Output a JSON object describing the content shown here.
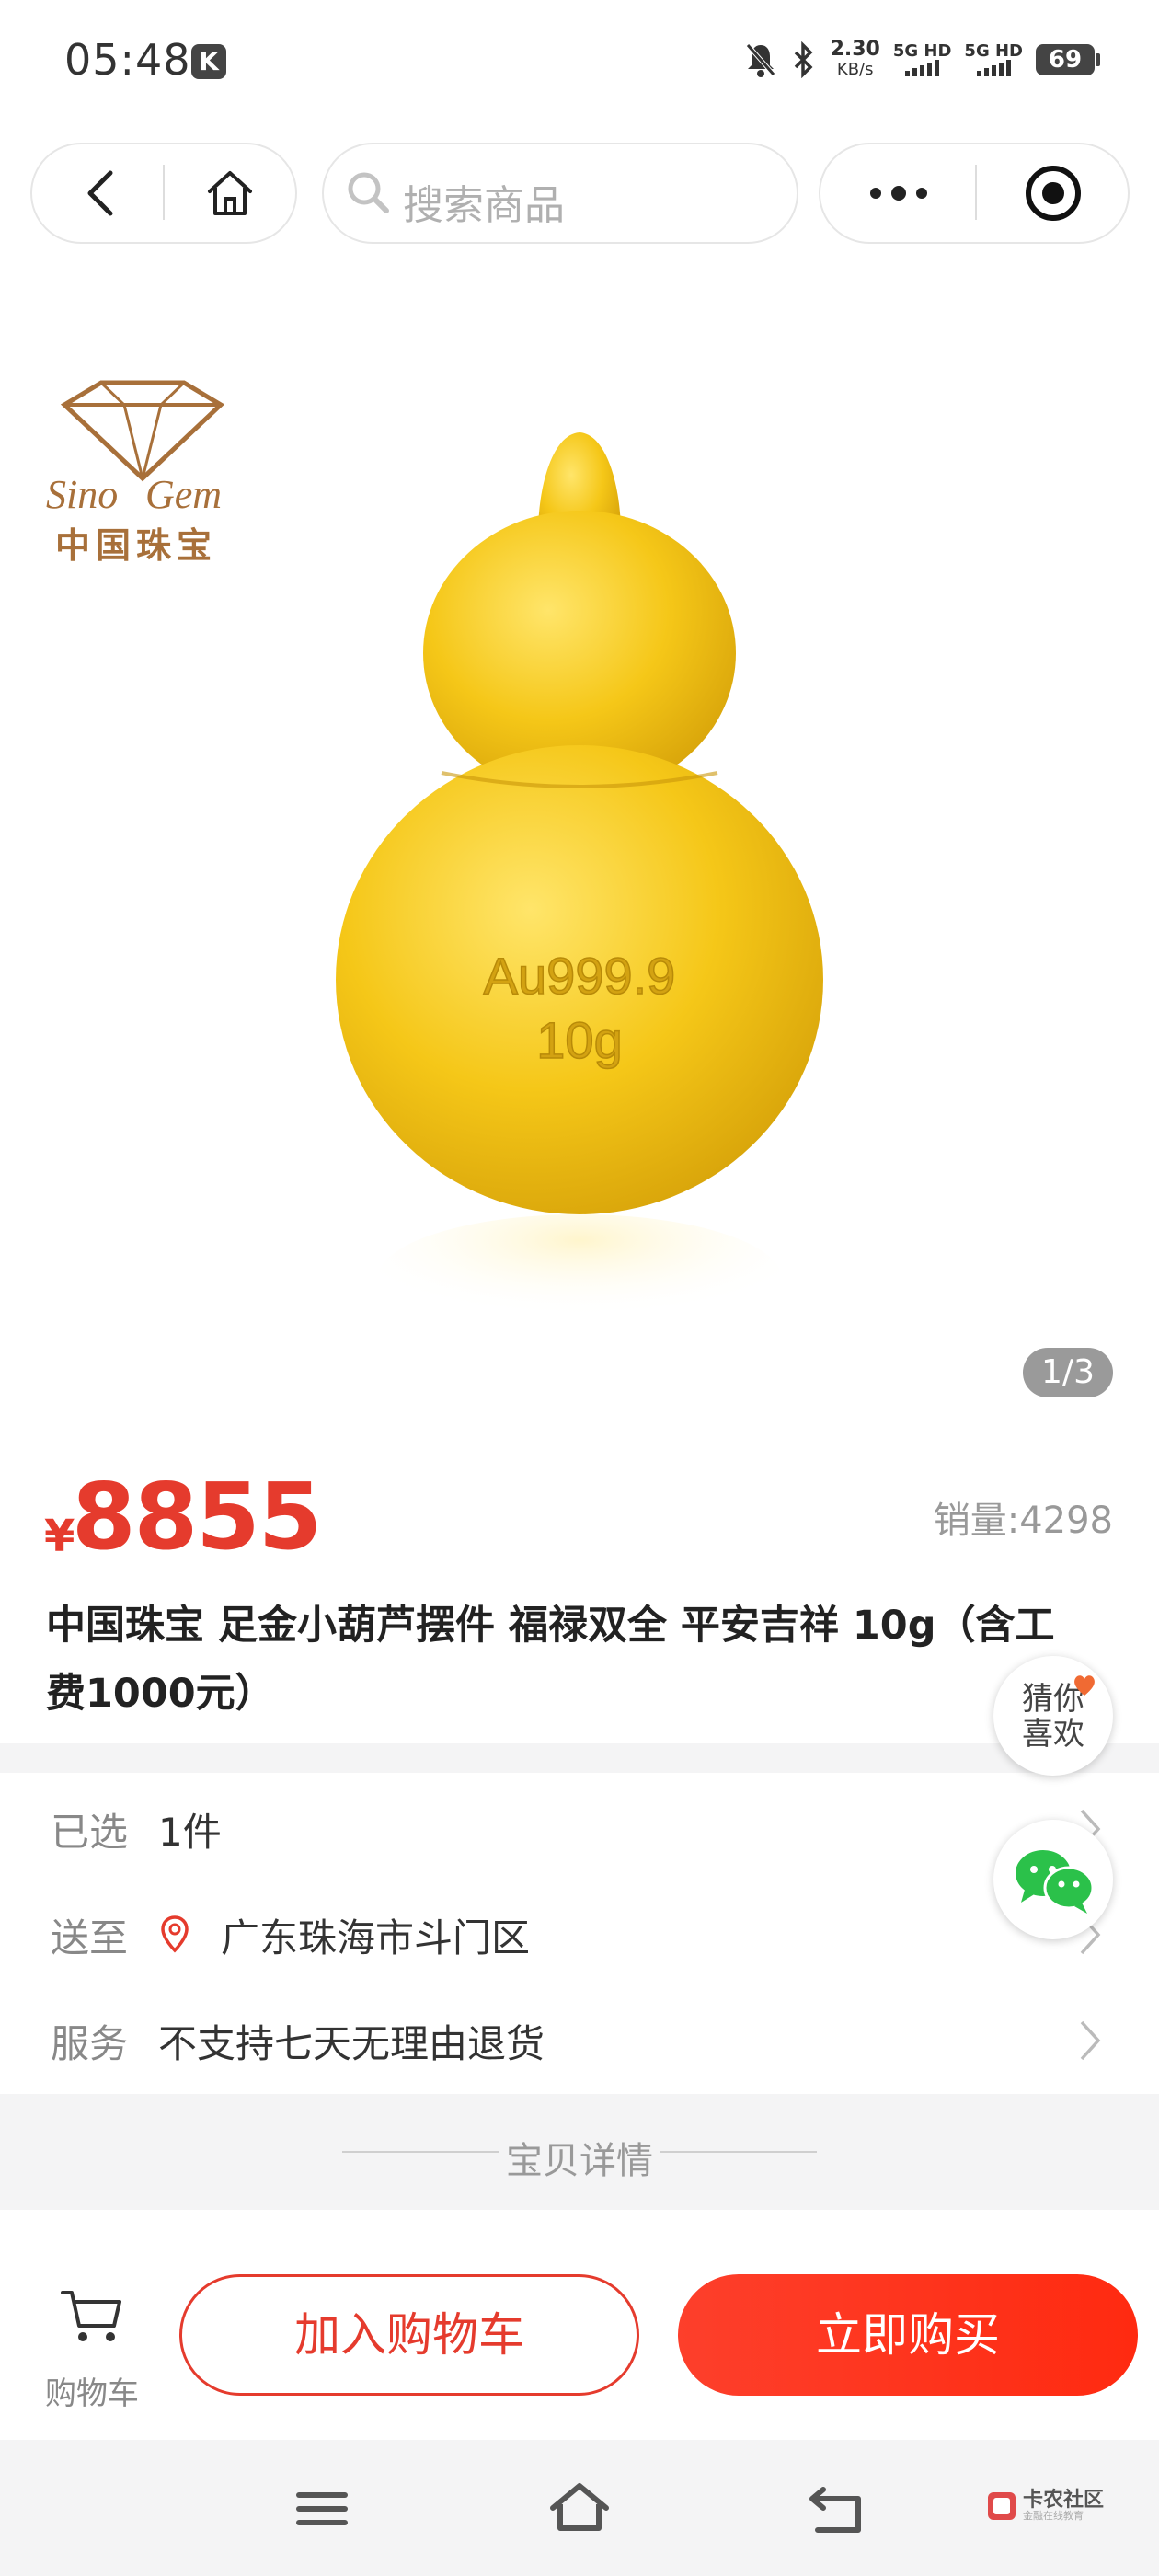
{
  "status_bar": {
    "time": "05:48",
    "app_badge": "K",
    "speed_value": "2.30",
    "speed_unit": "KB/s",
    "network_1": "5G HD",
    "network_2": "5G HD",
    "battery": "69"
  },
  "nav": {
    "search_placeholder": "搜索商品"
  },
  "gallery": {
    "logo_text": "Sino Gem",
    "logo_cn": "中国珠宝",
    "engraving_line1": "Au999.9",
    "engraving_line2": "10g",
    "page_indicator": "1/3"
  },
  "product": {
    "currency_symbol": "¥",
    "price": "8855",
    "sales": "销量:4298",
    "title": "中国珠宝 足金小葫芦摆件 福禄双全 平安吉祥 10g（含工费1000元）"
  },
  "info_rows": [
    {
      "label": "已选",
      "value": "1件"
    },
    {
      "label": "送至",
      "value": "广东珠海市斗门区"
    },
    {
      "label": "服务",
      "value": "不支持七天无理由退货"
    }
  ],
  "details": {
    "label": "宝贝详情"
  },
  "floating": {
    "guess_line1": "猜你",
    "guess_line2": "喜欢"
  },
  "actions": {
    "cart_label": "购物车",
    "add_to_cart": "加入购物车",
    "buy_now": "立即购买"
  },
  "watermark": {
    "text": "卡农社区",
    "sub": "金融在线教育"
  },
  "colors": {
    "accent": "#e53b2d",
    "buy_gradient_start": "#fd3f2b",
    "buy_gradient_end": "#ff2a10",
    "gold": "#f2c21a",
    "logo_brown": "#a8703a",
    "wechat_green": "#2bc14a"
  },
  "icons": [
    "back-icon",
    "home-icon",
    "search-icon",
    "more-icon",
    "target-icon",
    "location-pin-icon",
    "chevron-right-icon",
    "heart-icon",
    "wechat-icon",
    "cart-icon",
    "menu-icon",
    "system-home-icon",
    "system-back-icon"
  ]
}
